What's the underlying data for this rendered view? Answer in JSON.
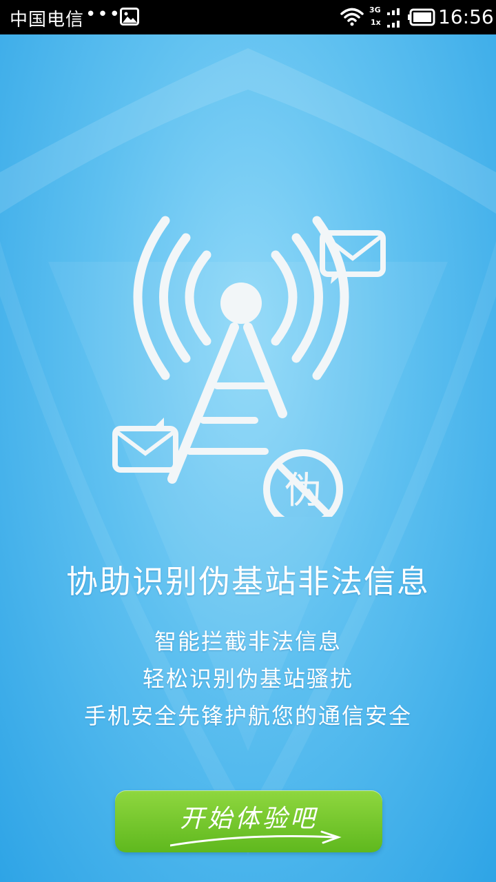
{
  "status_bar": {
    "carrier": "中国电信",
    "dots": "•••",
    "network_top": "3G",
    "network_bottom": "1x",
    "time": "16:56"
  },
  "illustration": {
    "badge_text": "伪"
  },
  "main": {
    "headline": "协助识别伪基站非法信息",
    "features": [
      "智能拦截非法信息",
      "轻松识别伪基站骚扰",
      "手机安全先锋护航您的通信安全"
    ],
    "start_button_label": "开始体验吧"
  },
  "colors": {
    "background_top": "#8fd8f8",
    "background_bottom": "#2ea4e6",
    "button_green": "#6cc42a",
    "icon_white": "#f2f6f8"
  }
}
